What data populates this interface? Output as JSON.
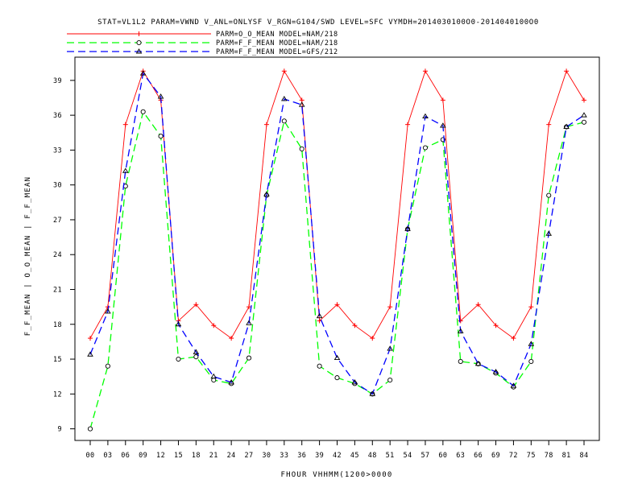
{
  "chart_data": {
    "type": "line",
    "title": "STAT=VL1L2 PARAM=VWND V_ANL=ONLYSF V_RGN=G104/SWD LEVEL=SFC VYMDH=2014030100O0-2014040100O0",
    "xlabel": "FHOUR VHHMM(1200>0000",
    "ylabel": "F_F_MEAN | O_O_MEAN | F_F_MEAN",
    "categories": [
      "00",
      "03",
      "06",
      "09",
      "12",
      "15",
      "18",
      "21",
      "24",
      "27",
      "30",
      "33",
      "36",
      "39",
      "42",
      "45",
      "48",
      "51",
      "54",
      "57",
      "60",
      "63",
      "66",
      "69",
      "72",
      "75",
      "78",
      "81",
      "84"
    ],
    "yticks": [
      "9",
      "12",
      "15",
      "18",
      "21",
      "24",
      "27",
      "30",
      "33",
      "36",
      "39"
    ],
    "ylim": [
      8.0,
      41.0
    ],
    "grid": false,
    "legend_position": "top-left",
    "series": [
      {
        "name": "PARM=O_O_MEAN MODEL=NAM/218",
        "color": "#ff0000",
        "marker": "plus",
        "dash": "solid",
        "values": [
          16.8,
          19.5,
          35.2,
          39.8,
          37.3,
          18.3,
          19.7,
          17.9,
          16.8,
          19.5,
          35.2,
          39.8,
          37.3,
          18.3,
          19.7,
          17.9,
          16.8,
          19.5,
          35.2,
          39.8,
          37.3,
          18.3,
          19.7,
          17.9,
          16.8,
          19.5,
          35.2,
          39.8,
          37.3
        ]
      },
      {
        "name": "PARM=F_F_MEAN MODEL=NAM/218",
        "color": "#00ff00",
        "marker": "circle",
        "dash": "dashed",
        "values": [
          9.0,
          14.4,
          29.9,
          36.3,
          34.2,
          15.0,
          15.2,
          13.2,
          12.9,
          15.1,
          29.1,
          35.5,
          33.1,
          14.4,
          13.4,
          12.9,
          12.0,
          13.2,
          26.2,
          33.2,
          33.9,
          14.8,
          14.6,
          13.8,
          12.6,
          14.8,
          29.1,
          35.0,
          35.4
        ]
      },
      {
        "name": "PARM=F_F_MEAN MODEL=GFS/212",
        "color": "#0000ff",
        "marker": "triangle",
        "dash": "dashed",
        "values": [
          15.4,
          19.1,
          31.2,
          39.6,
          37.6,
          18.0,
          15.6,
          13.5,
          13.0,
          18.1,
          29.2,
          37.4,
          36.9,
          18.7,
          15.1,
          13.0,
          12.0,
          15.9,
          26.2,
          35.9,
          35.1,
          17.4,
          14.6,
          13.9,
          12.7,
          16.3,
          25.8,
          35.0,
          36.0
        ]
      }
    ]
  }
}
